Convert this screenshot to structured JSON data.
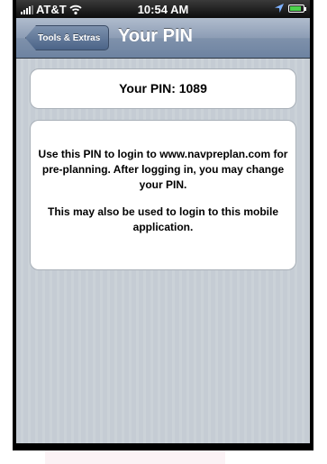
{
  "status_bar": {
    "carrier": "AT&T",
    "time": "10:54 AM",
    "icons": [
      "signal-bars-icon",
      "wifi-icon",
      "location-arrow-icon",
      "battery-icon"
    ],
    "battery_color": "#4cd24c"
  },
  "nav": {
    "back_label": "Tools & Extras",
    "title": "Your PIN"
  },
  "pin_card": {
    "text": "Your PIN: 1089"
  },
  "info_card": {
    "paragraph_1": "Use this PIN to login to www.navpreplan.com for pre-planning. After logging in, you may change your PIN.",
    "paragraph_2": "This may also be used to login to this mobile application."
  }
}
